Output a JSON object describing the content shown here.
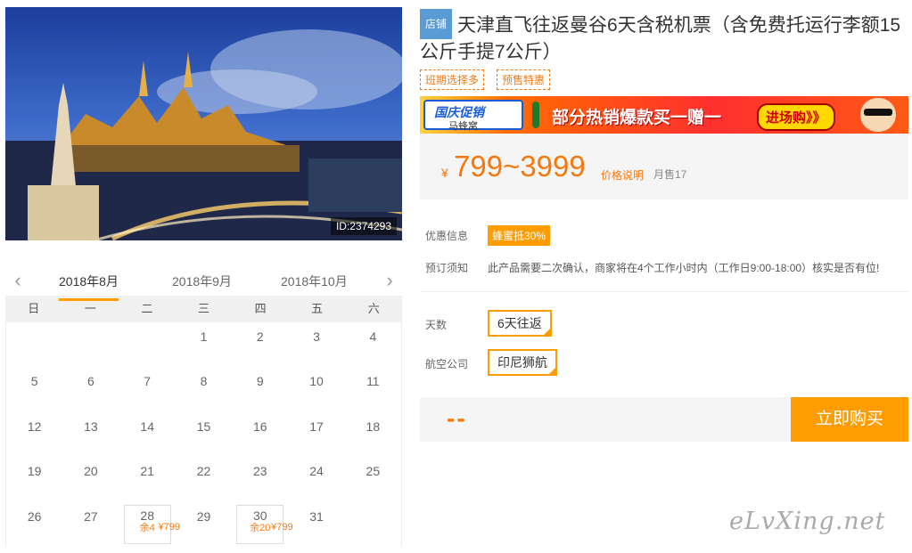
{
  "hero": {
    "image_id": "ID:2374293"
  },
  "calendar": {
    "months": [
      "2018年8月",
      "2018年9月",
      "2018年10月"
    ],
    "active_month": 0,
    "weekdays": [
      "日",
      "一",
      "二",
      "三",
      "四",
      "五",
      "六"
    ],
    "leading_blanks": 3,
    "days": [
      "1",
      "2",
      "3",
      "4",
      "5",
      "6",
      "7",
      "8",
      "9",
      "10",
      "11",
      "12",
      "13",
      "14",
      "15",
      "16",
      "17",
      "18",
      "19",
      "20",
      "21",
      "22",
      "23",
      "24",
      "25",
      "26",
      "27",
      "28",
      "29",
      "30",
      "31"
    ],
    "available": {
      "28": {
        "price": "¥799",
        "remain": "余4"
      },
      "30": {
        "price": "¥799",
        "remain": "余20"
      }
    }
  },
  "product": {
    "shop_badge": "店铺",
    "title": "天津直飞往返曼谷6天含税机票（含免费托运行李额15公斤手提7公斤）",
    "tags": [
      "班期选择多",
      "预售特惠"
    ]
  },
  "banner": {
    "promo": "国庆促销",
    "brand": "马蜂窝",
    "headline": "部分热销爆款买一赠一",
    "cta": "进场购》》"
  },
  "price": {
    "currency": "¥",
    "range": "799~3999",
    "note": "价格说明",
    "sold": "月售17"
  },
  "info": {
    "discount_label": "优惠信息",
    "discount_value": "蜂蜜抵30%",
    "booking_label": "预订须知",
    "booking_value": "此产品需要二次确认，商家将在4个工作小时内（工作日9:00-18:00）核实是否有位!"
  },
  "options": {
    "days_label": "天数",
    "days_value": "6天往返",
    "airline_label": "航空公司",
    "airline_value": "印尼狮航"
  },
  "buy": {
    "total": "--",
    "button": "立即购买"
  },
  "watermark": "eLvXing.net",
  "colors": {
    "accent": "#ff9d00",
    "price": "#f5780f",
    "badge": "#5b9bd5"
  }
}
